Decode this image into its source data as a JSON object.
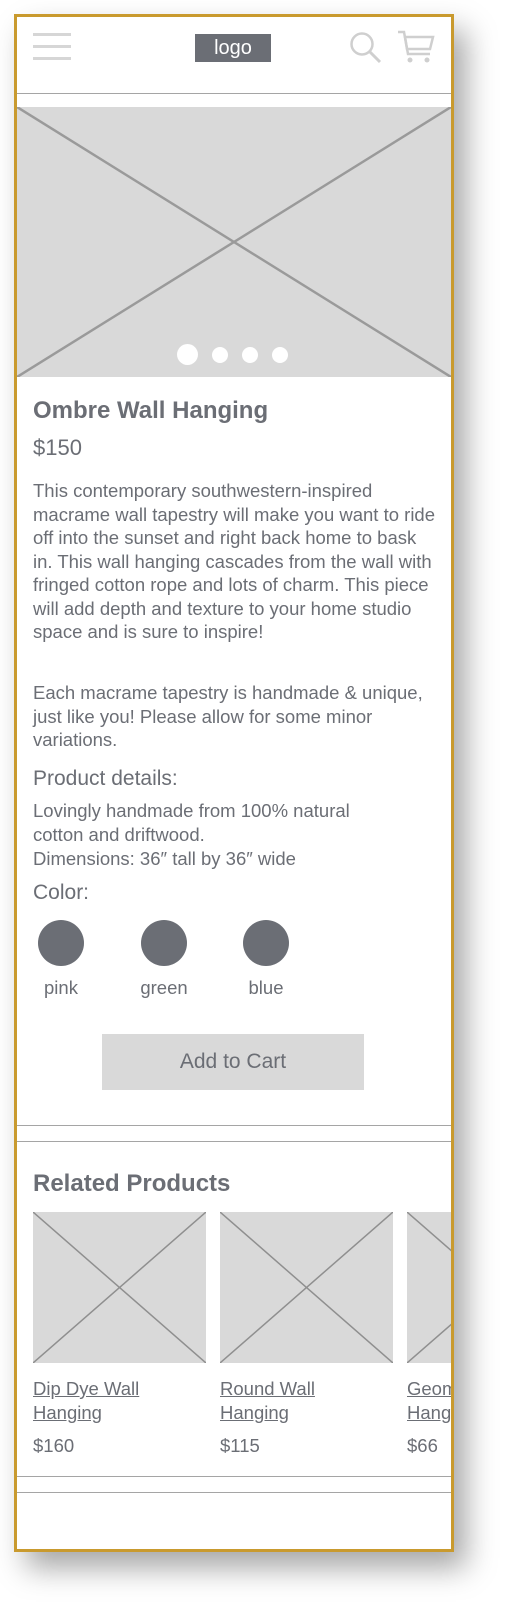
{
  "header": {
    "logo_text": "logo",
    "menu_icon": "hamburger-menu-icon",
    "search_icon": "search-icon",
    "cart_icon": "cart-icon"
  },
  "product": {
    "title": "Ombre Wall Hanging",
    "price": "$150",
    "description": "This contemporary southwestern-inspired macrame wall tapestry will make you want to ride off into the sunset and right back home to bask in. This wall hanging cascades from the wall with fringed cotton rope and lots of charm. This piece will add depth and texture to your home studio space and is sure to inspire!",
    "description2": "Each macrame tapestry is handmade & unique, just like you! Please allow for some minor variations.",
    "details_heading": "Product details:",
    "details_lines": [
      "Lovingly handmade from 100% natural",
      "cotton and driftwood.",
      "Dimensions: 36″ tall by 36″ wide"
    ],
    "color_heading": "Color:",
    "colors": [
      "pink",
      "green",
      "blue"
    ],
    "add_to_cart_label": "Add to Cart",
    "carousel_slides": 4,
    "carousel_active_index": 0
  },
  "related": {
    "heading": "Related Products",
    "items": [
      {
        "name_line1": "Dip Dye Wall",
        "name_line2": "Hanging",
        "price": "$160"
      },
      {
        "name_line1": "Round Wall",
        "name_line2": "Hanging",
        "price": "$115"
      },
      {
        "name_line1": "Geometric Wall",
        "name_line2": "Hanging",
        "price": "$66"
      }
    ]
  },
  "colors": {
    "frame_border": "#c99a2e",
    "text": "#6b6e75",
    "placeholder": "#d9d9d9"
  }
}
